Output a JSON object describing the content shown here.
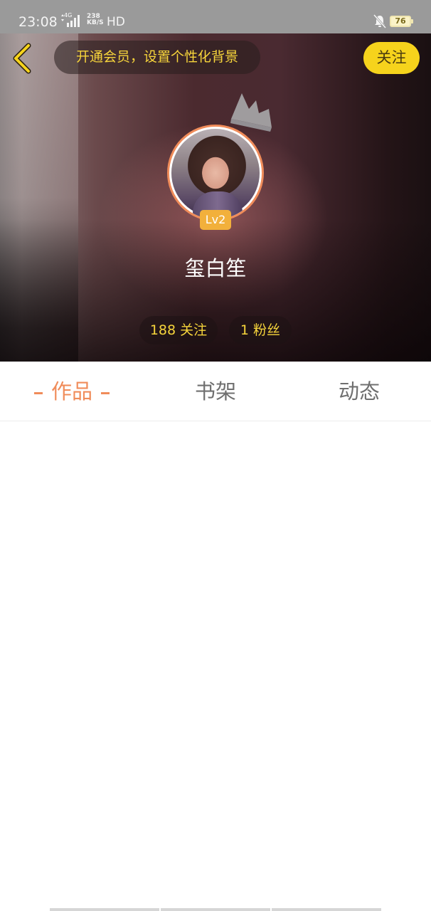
{
  "status_bar": {
    "time": "23:08",
    "network": "4G",
    "speed": "238 KB/S",
    "hd": "HD",
    "battery": "76",
    "icons": [
      "signal-icon",
      "bell-off-icon",
      "battery-icon"
    ]
  },
  "header": {
    "back_icon": "chevron-left-icon",
    "vip_prompt": "开通会员，设置个性化背景",
    "follow_label": "关注"
  },
  "profile": {
    "level": "Lv2",
    "name": "玺白笙",
    "following": "188 关注",
    "fans": "1 粉丝"
  },
  "tabs": [
    {
      "label": "作品",
      "active": true
    },
    {
      "label": "书架",
      "active": false
    },
    {
      "label": "动态",
      "active": false
    }
  ],
  "colors": {
    "accent": "#f08c5a",
    "yellow": "#f6d31c",
    "stat_text": "#f7d53b"
  }
}
